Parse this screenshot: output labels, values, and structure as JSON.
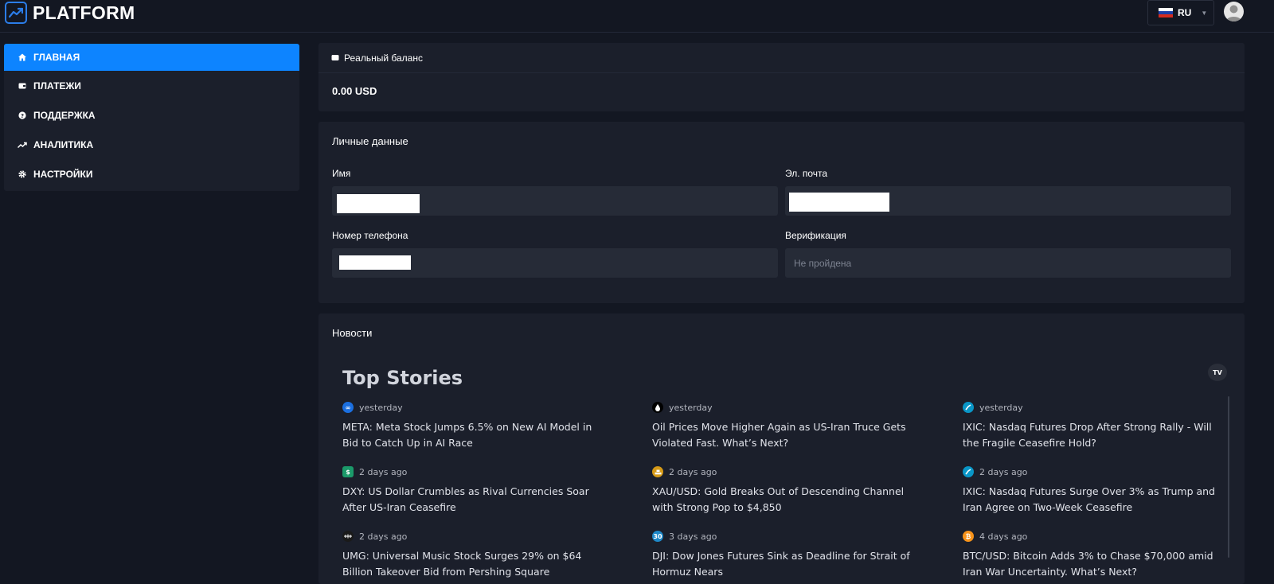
{
  "header": {
    "logo_text": "PLATFORM",
    "language": {
      "label": "RU",
      "flag_colors": [
        "#ffffff",
        "#1c3fa8",
        "#d52b1e"
      ]
    }
  },
  "sidebar": {
    "items": [
      {
        "label": "ГЛАВНАЯ",
        "icon": "home-icon",
        "active": true
      },
      {
        "label": "ПЛАТЕЖИ",
        "icon": "wallet-icon",
        "active": false
      },
      {
        "label": "ПОДДЕРЖКА",
        "icon": "help-icon",
        "active": false
      },
      {
        "label": "АНАЛИТИКА",
        "icon": "trending-up-icon",
        "active": false
      },
      {
        "label": "НАСТРОЙКИ",
        "icon": "gear-icon",
        "active": false
      }
    ]
  },
  "balance": {
    "title": "Реальный баланс",
    "value": "0.00 USD"
  },
  "personal": {
    "title": "Личные данные",
    "name_label": "Имя",
    "email_label": "Эл. почта",
    "phone_label": "Номер телефона",
    "verification_label": "Верификация",
    "verification_value": "Не пройдена"
  },
  "news": {
    "title": "Новости",
    "widget_title": "Top Stories",
    "stories": [
      {
        "time": "yesterday",
        "icon": "meta-icon",
        "icon_color": "#1b6fe0",
        "headline": "META: Meta Stock Jumps 6.5% on New AI Model in Bid to Catch Up in AI Race"
      },
      {
        "time": "yesterday",
        "icon": "oil-drop-icon",
        "icon_color": "#000000",
        "headline": "Oil Prices Move Higher Again as US-Iran Truce Gets Violated Fast. What’s Next?"
      },
      {
        "time": "yesterday",
        "icon": "nasdaq-icon",
        "icon_color": "#0996c7",
        "headline": "IXIC: Nasdaq Futures Drop After Strong Rally - Will the Fragile Ceasefire Hold?"
      },
      {
        "time": "2 days ago",
        "icon": "dollar-icon",
        "icon_color": "#1b9a6a",
        "headline": "DXY: US Dollar Crumbles as Rival Currencies Soar After US-Iran Ceasefire"
      },
      {
        "time": "2 days ago",
        "icon": "gold-icon",
        "icon_color": "#d69a17",
        "headline": "XAU/USD: Gold Breaks Out of Descending Channel with Strong Pop to $4,850"
      },
      {
        "time": "2 days ago",
        "icon": "nasdaq-icon",
        "icon_color": "#0996c7",
        "headline": "IXIC: Nasdaq Futures Surge Over 3% as Trump and Iran Agree on Two-Week Ceasefire"
      },
      {
        "time": "2 days ago",
        "icon": "umg-icon",
        "icon_color": "#1a1a1a",
        "headline": "UMG: Universal Music Stock Surges 29% on $64 Billion Takeover Bid from Pershing Square"
      },
      {
        "time": "3 days ago",
        "icon": "dow-30-icon",
        "icon_color": "#1e88c8",
        "icon_text": "30",
        "headline": "DJI: Dow Jones Futures Sink as Deadline for Strait of Hormuz Nears"
      },
      {
        "time": "4 days ago",
        "icon": "bitcoin-icon",
        "icon_color": "#f7931a",
        "icon_text": "₿",
        "headline": "BTC/USD: Bitcoin Adds 3% to Chase $70,000 amid Iran War Uncertainty. What’s Next?"
      }
    ]
  }
}
